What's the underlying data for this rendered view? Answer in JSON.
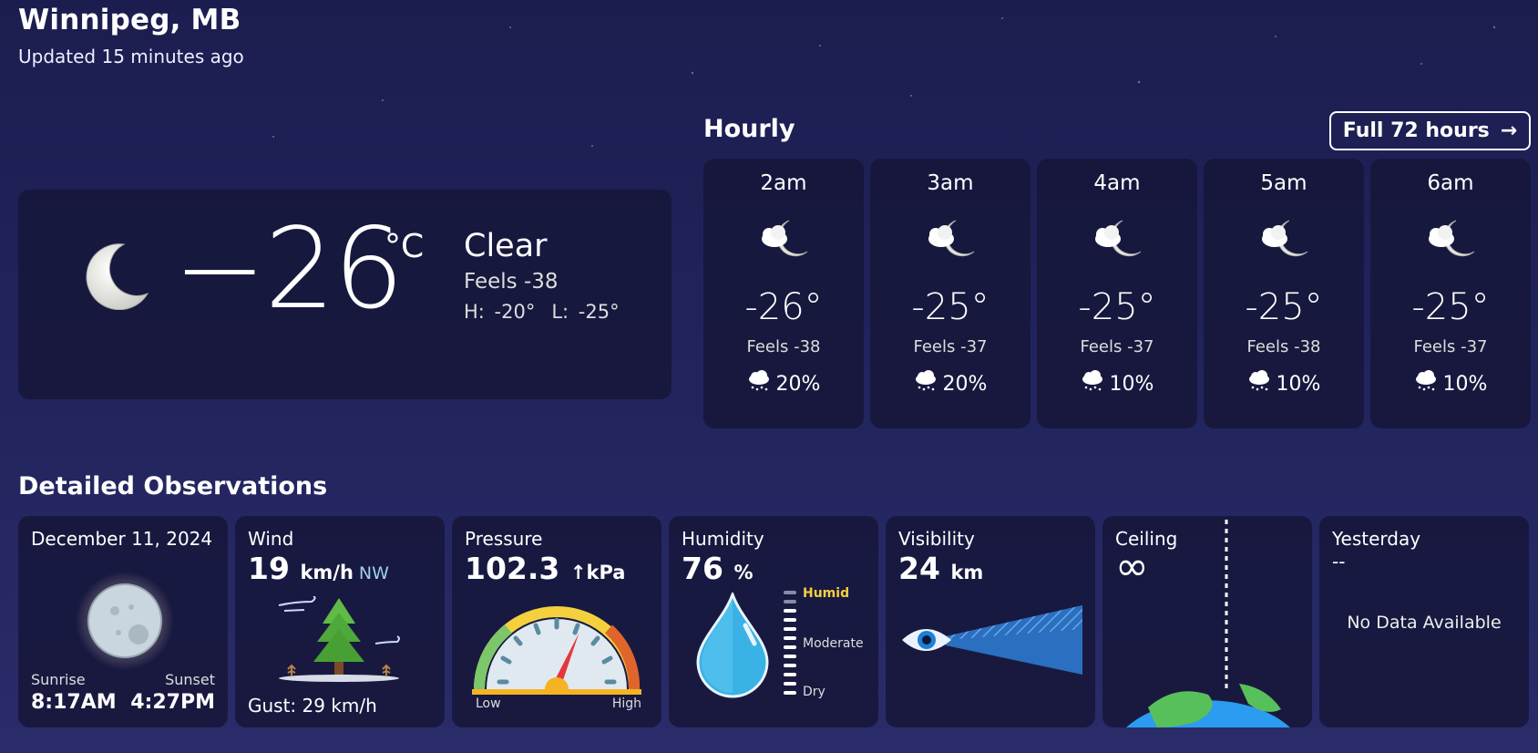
{
  "header": {
    "city": "Winnipeg, MB",
    "updated": "Updated 15 minutes ago"
  },
  "current": {
    "temp": "−26",
    "unit": "°C",
    "condition": "Clear",
    "feels": "Feels -38",
    "high": "H: -20°",
    "low": "L: -25°",
    "icon": "moon-icon"
  },
  "hourly": {
    "title": "Hourly",
    "full_button": "Full 72 hours",
    "items": [
      {
        "time": "2am",
        "temp": "-26°",
        "feels": "Feels -38",
        "pop": "20%",
        "icon": "cloudy-moon-icon"
      },
      {
        "time": "3am",
        "temp": "-25°",
        "feels": "Feels -37",
        "pop": "20%",
        "icon": "cloudy-moon-icon"
      },
      {
        "time": "4am",
        "temp": "-25°",
        "feels": "Feels -37",
        "pop": "10%",
        "icon": "cloudy-moon-icon"
      },
      {
        "time": "5am",
        "temp": "-25°",
        "feels": "Feels -38",
        "pop": "10%",
        "icon": "cloudy-moon-icon"
      },
      {
        "time": "6am",
        "temp": "-25°",
        "feels": "Feels -37",
        "pop": "10%",
        "icon": "cloudy-moon-icon"
      }
    ]
  },
  "observations": {
    "title": "Detailed Observations",
    "date": {
      "label": "December 11, 2024",
      "sunrise_label": "Sunrise",
      "sunrise": "8:17AM",
      "sunset_label": "Sunset",
      "sunset": "4:27PM"
    },
    "wind": {
      "label": "Wind",
      "value": "19",
      "unit": "km/h",
      "direction": "NW",
      "gust": "Gust: 29 km/h"
    },
    "pressure": {
      "label": "Pressure",
      "value": "102.3",
      "unit": "↑kPa",
      "low": "Low",
      "high": "High",
      "level": 0.62
    },
    "humidity": {
      "label": "Humidity",
      "value": "76",
      "unit": "%",
      "humid": "Humid",
      "moderate": "Moderate",
      "dry": "Dry"
    },
    "visibility": {
      "label": "Visibility",
      "value": "24",
      "unit": "km"
    },
    "ceiling": {
      "label": "Ceiling",
      "value": "∞"
    },
    "yesterday": {
      "label": "Yesterday",
      "value": "--",
      "message": "No Data Available"
    }
  },
  "colors": {
    "background": "#1f2157",
    "card": "#16163a",
    "accent_humid": "#f4d03f",
    "direction": "#9fd0ea"
  }
}
